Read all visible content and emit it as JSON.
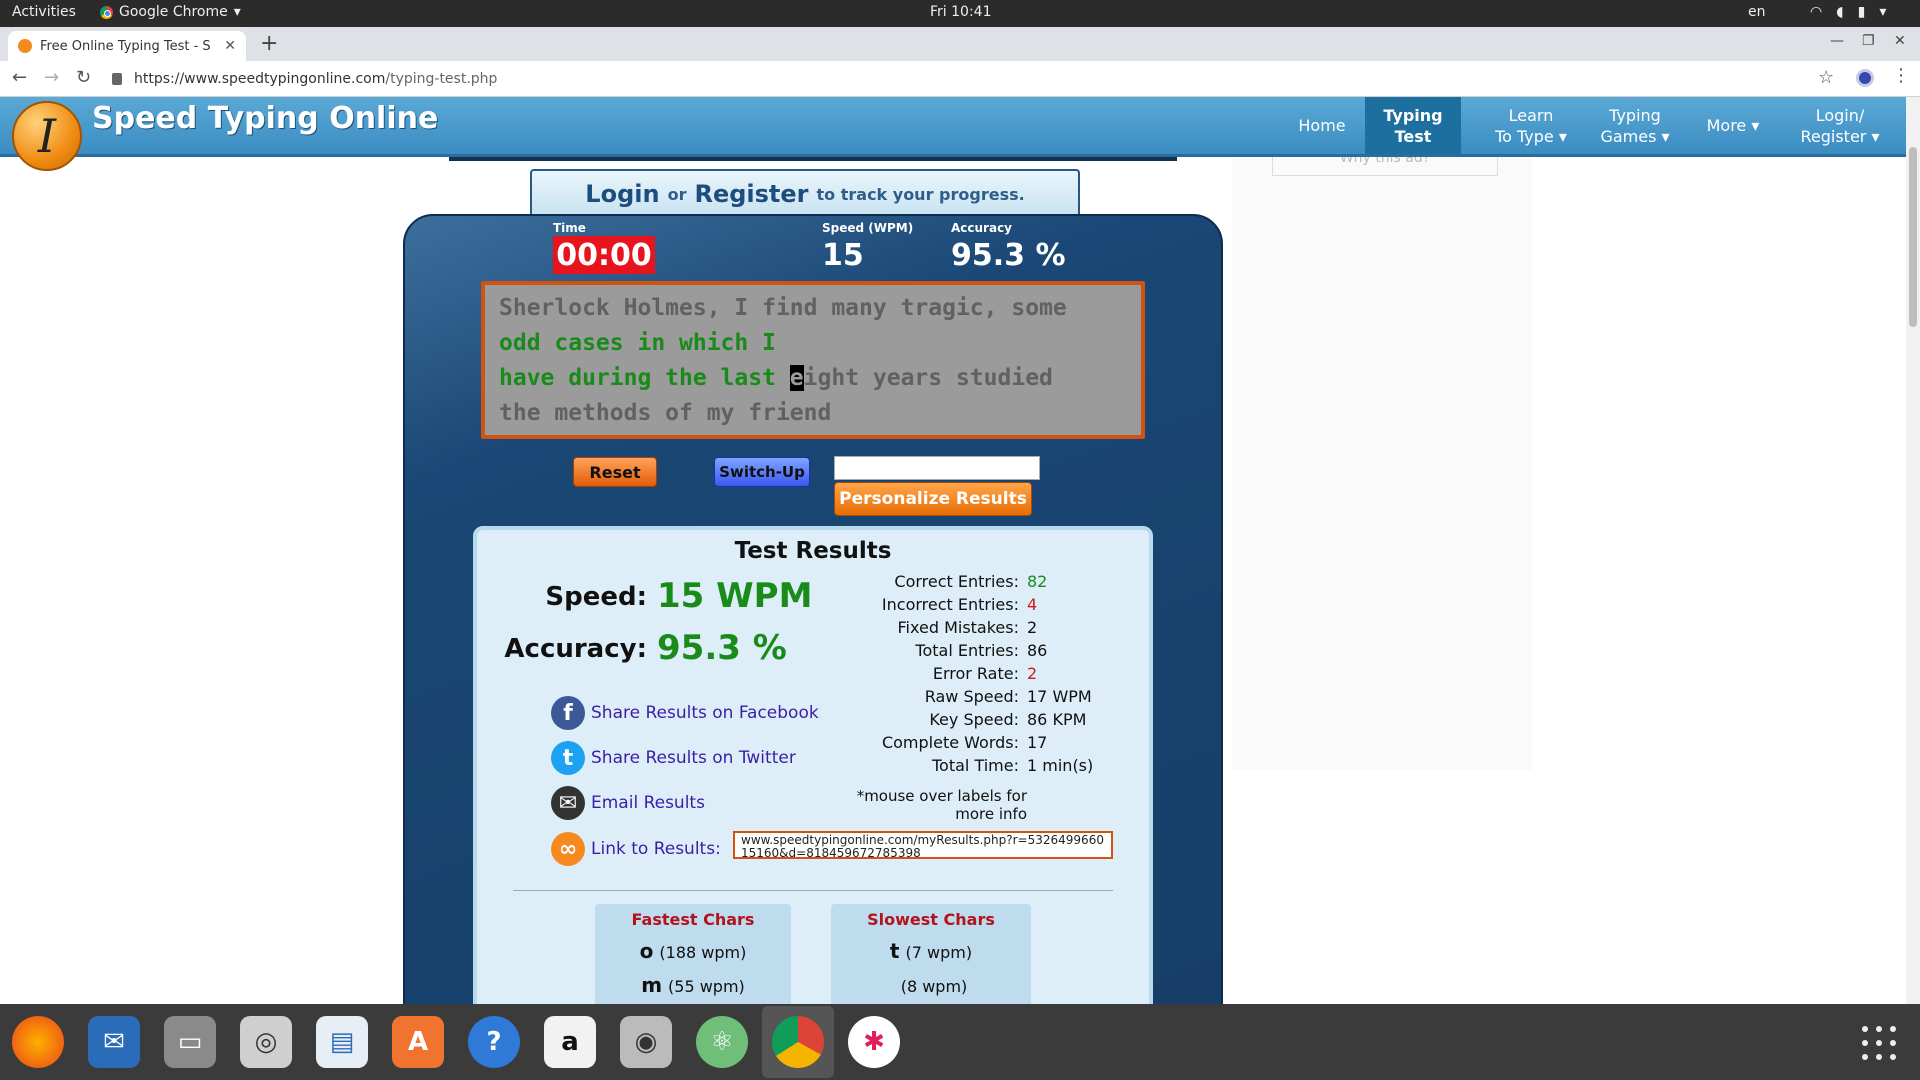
{
  "topbar": {
    "activities": "Activities",
    "app_name": "Google Chrome",
    "clock": "Fri 10:41",
    "lang": "en"
  },
  "browser": {
    "tab_title": "Free Online Typing Test - S",
    "url_host": "https://www.speedtypingonline.com",
    "url_path": "/typing-test.php"
  },
  "site": {
    "title": "Speed Typing Online",
    "logo_letter": "I",
    "nav": {
      "home": "Home",
      "typing_test_1": "Typing",
      "typing_test_2": "Test",
      "learn_1": "Learn",
      "learn_2": "To Type",
      "games_1": "Typing",
      "games_2": "Games",
      "more": "More",
      "login_1": "Login/",
      "login_2": "Register"
    },
    "ad_label": "Why this ad?",
    "banner": {
      "login": "Login",
      "or": "or",
      "register": "Register",
      "tail": "to track your progress."
    }
  },
  "test": {
    "time_label": "Time",
    "time_value": "00:00",
    "speed_label": "Speed (WPM)",
    "speed_value": "15",
    "accuracy_label": "Accuracy",
    "accuracy_value": "95.3 %",
    "line1": "Sherlock Holmes, I find many tragic, some",
    "line2_typed": "odd cases in which I",
    "line3_typed": "have during the last ",
    "line3_cursor": "e",
    "line3_rest": "ight years studied",
    "line4": "the methods of my friend",
    "reset": "Reset",
    "switch_up": "Switch-Up",
    "personalize": "Personalize Results"
  },
  "results": {
    "title": "Test Results",
    "speed_label": "Speed:",
    "speed_value": "15 WPM",
    "accuracy_label": "Accuracy:",
    "accuracy_value": "95.3 %",
    "share_facebook": "Share Results on Facebook",
    "share_twitter": "Share Results on Twitter",
    "email": "Email Results",
    "link": "Link to Results:",
    "link_url": "www.speedtypingonline.com/myResults.php?r=532649966015160&d=818459672785398",
    "stats": [
      {
        "k": "Correct Entries:",
        "v": "82"
      },
      {
        "k": "Incorrect Entries:",
        "v": "4"
      },
      {
        "k": "Fixed Mistakes:",
        "v": "2"
      },
      {
        "k": "Total Entries:",
        "v": "86"
      },
      {
        "k": "Error Rate:",
        "v": "2"
      },
      {
        "k": "Raw Speed:",
        "v": "17 WPM"
      },
      {
        "k": "Key Speed:",
        "v": "86 KPM"
      },
      {
        "k": "Complete Words:",
        "v": "17"
      },
      {
        "k": "Total Time:",
        "v": "1 min(s)"
      }
    ],
    "note": "*mouse over labels for more info",
    "fastest_title": "Fastest Chars",
    "fastest": [
      {
        "ch": "o",
        "wpm": "(188 wpm)"
      },
      {
        "ch": "m",
        "wpm": "(55 wpm)"
      }
    ],
    "slowest_title": "Slowest Chars",
    "slowest": [
      {
        "ch": "t",
        "wpm": "(7 wpm)"
      },
      {
        "ch": "",
        "wpm": "(8 wpm)"
      }
    ]
  },
  "colors": {
    "green": "#1a8a1a",
    "red": "#d01a1a",
    "nav_blue": "#3b8cc2",
    "orange": "#e86d05"
  }
}
